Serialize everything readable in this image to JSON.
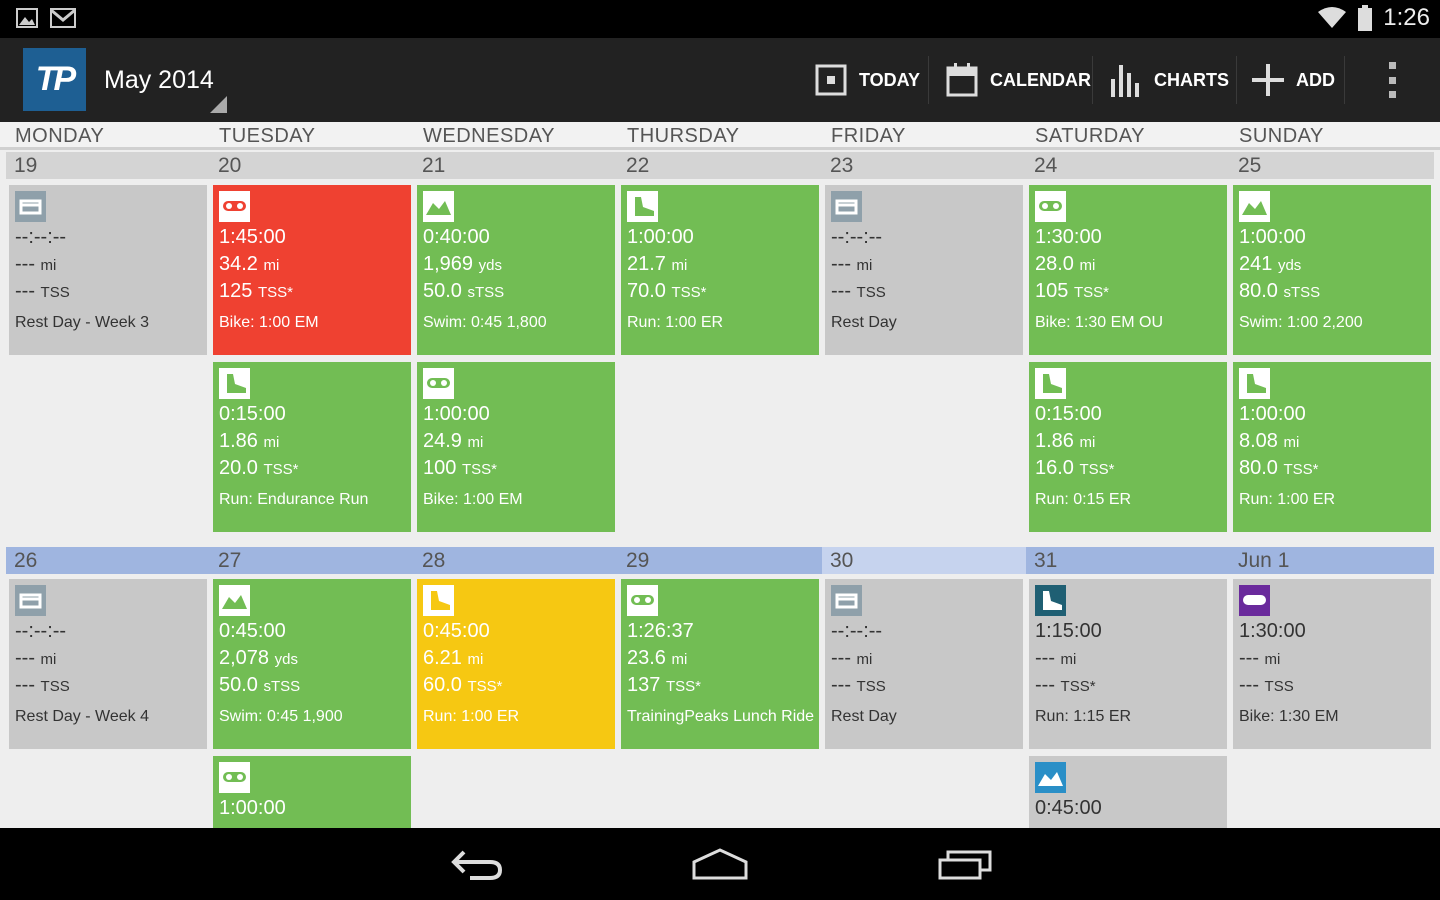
{
  "status_bar": {
    "time": "1:26"
  },
  "action_bar": {
    "logo_text": "TP",
    "month_label": "May 2014",
    "buttons": {
      "today": "TODAY",
      "calendar": "CALENDAR",
      "charts": "CHARTS",
      "add": "ADD"
    }
  },
  "day_headers": [
    "MONDAY",
    "TUESDAY",
    "WEDNESDAY",
    "THURSDAY",
    "FRIDAY",
    "SATURDAY",
    "SUNDAY"
  ],
  "weeks": [
    {
      "dates": [
        "19",
        "20",
        "21",
        "22",
        "23",
        "24",
        "25"
      ],
      "row1": [
        {
          "color": "gray",
          "icon": "rest",
          "duration": "--:--:--",
          "distance": "---",
          "dist_unit": "mi",
          "score": "---",
          "score_unit": "TSS",
          "title": "Rest Day - Week 3"
        },
        {
          "color": "red",
          "icon": "bike",
          "duration": "1:45:00",
          "distance": "34.2",
          "dist_unit": "mi",
          "score": "125",
          "score_unit": "TSS*",
          "title": "Bike: 1:00 EM"
        },
        {
          "color": "green",
          "icon": "swim",
          "duration": "0:40:00",
          "distance": "1,969",
          "dist_unit": "yds",
          "score": "50.0",
          "score_unit": "sTSS",
          "title": "Swim: 0:45 1,800"
        },
        {
          "color": "green",
          "icon": "run",
          "duration": "1:00:00",
          "distance": "21.7",
          "dist_unit": "mi",
          "score": "70.0",
          "score_unit": "TSS*",
          "title": "Run: 1:00 ER"
        },
        {
          "color": "gray",
          "icon": "rest",
          "duration": "--:--:--",
          "distance": "---",
          "dist_unit": "mi",
          "score": "---",
          "score_unit": "TSS",
          "title": "Rest Day"
        },
        {
          "color": "green",
          "icon": "bike",
          "duration": "1:30:00",
          "distance": "28.0",
          "dist_unit": "mi",
          "score": "105",
          "score_unit": "TSS*",
          "title": "Bike: 1:30 EM OU"
        },
        {
          "color": "green",
          "icon": "swim",
          "duration": "1:00:00",
          "distance": "241",
          "dist_unit": "yds",
          "score": "80.0",
          "score_unit": "sTSS",
          "title": "Swim: 1:00 2,200"
        }
      ],
      "row2": [
        null,
        {
          "color": "green",
          "icon": "run",
          "duration": "0:15:00",
          "distance": "1.86",
          "dist_unit": "mi",
          "score": "20.0",
          "score_unit": "TSS*",
          "title": "Run: Endurance Run"
        },
        {
          "color": "green",
          "icon": "bike",
          "duration": "1:00:00",
          "distance": "24.9",
          "dist_unit": "mi",
          "score": "100",
          "score_unit": "TSS*",
          "title": "Bike: 1:00 EM"
        },
        null,
        null,
        {
          "color": "green",
          "icon": "run",
          "duration": "0:15:00",
          "distance": "1.86",
          "dist_unit": "mi",
          "score": "16.0",
          "score_unit": "TSS*",
          "title": "Run: 0:15 ER"
        },
        {
          "color": "green",
          "icon": "run",
          "duration": "1:00:00",
          "distance": "8.08",
          "dist_unit": "mi",
          "score": "80.0",
          "score_unit": "TSS*",
          "title": "Run: 1:00 ER"
        }
      ]
    },
    {
      "dates": [
        "26",
        "27",
        "28",
        "29",
        "30",
        "31",
        "Jun 1"
      ],
      "row1": [
        {
          "color": "gray",
          "icon": "rest",
          "duration": "--:--:--",
          "distance": "---",
          "dist_unit": "mi",
          "score": "---",
          "score_unit": "TSS",
          "title": "Rest Day - Week 4"
        },
        {
          "color": "green",
          "icon": "swim",
          "duration": "0:45:00",
          "distance": "2,078",
          "dist_unit": "yds",
          "score": "50.0",
          "score_unit": "sTSS",
          "title": "Swim: 0:45 1,900"
        },
        {
          "color": "yellow",
          "icon": "run",
          "duration": "0:45:00",
          "distance": "6.21",
          "dist_unit": "mi",
          "score": "60.0",
          "score_unit": "TSS*",
          "title": "Run: 1:00 ER"
        },
        {
          "color": "green",
          "icon": "bike",
          "duration": "1:26:37",
          "distance": "23.6",
          "dist_unit": "mi",
          "score": "137",
          "score_unit": "TSS*",
          "title": "TrainingPeaks Lunch Ride"
        },
        {
          "color": "gray",
          "icon": "rest",
          "duration": "--:--:--",
          "distance": "---",
          "dist_unit": "mi",
          "score": "---",
          "score_unit": "TSS",
          "title": "Rest Day"
        },
        {
          "color": "gray",
          "icon": "run",
          "icon_bg": "#1f5f73",
          "duration": "1:15:00",
          "distance": "---",
          "dist_unit": "mi",
          "score": "---",
          "score_unit": "TSS*",
          "title": "Run: 1:15 ER"
        },
        {
          "color": "gray",
          "icon": "bike",
          "icon_bg": "#6a2a9c",
          "duration": "1:30:00",
          "distance": "---",
          "dist_unit": "mi",
          "score": "---",
          "score_unit": "TSS",
          "title": "Bike: 1:30 EM"
        }
      ],
      "row2": [
        null,
        {
          "color": "green",
          "icon": "bike",
          "duration": "1:00:00"
        },
        null,
        null,
        null,
        {
          "color": "gray",
          "icon": "swim",
          "icon_bg": "#2a8fc7",
          "duration": "0:45:00"
        },
        null
      ]
    }
  ],
  "colors": {
    "green": "#72bd54",
    "red": "#ef4131",
    "yellow": "#f6c812",
    "gray": "#c8c8c8",
    "week_highlight": "#9fb5e0",
    "today_highlight": "#c6d3ee"
  },
  "nav": {
    "back": "back-icon",
    "home": "home-icon",
    "recents": "recents-icon"
  }
}
